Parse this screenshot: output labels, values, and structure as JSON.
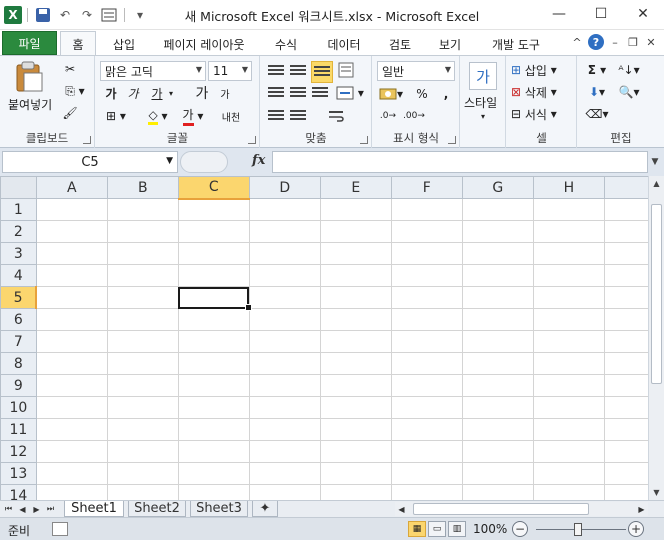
{
  "window": {
    "title": "새 Microsoft Excel 워크시트.xlsx  -  Microsoft Excel",
    "controls": {
      "minimize": "—",
      "restore": "☐",
      "close": "✕"
    }
  },
  "qat": {
    "logo": "X",
    "undo": "↶",
    "redo": "↷",
    "dropdown": "▾"
  },
  "tabs": {
    "file": "파일",
    "items": [
      {
        "label": "홈",
        "active": true
      },
      {
        "label": "삽입"
      },
      {
        "label": "페이지 레이아웃"
      },
      {
        "label": "수식"
      },
      {
        "label": "데이터"
      },
      {
        "label": "검토"
      },
      {
        "label": "보기"
      },
      {
        "label": "개발 도구"
      }
    ]
  },
  "ribbon": {
    "clipboard": {
      "paste_label": "붙여넣기",
      "group_label": "클립보드"
    },
    "font": {
      "font_name": "맑은 고딕",
      "font_size": "11",
      "bold": "가",
      "italic": "가",
      "underline": "가",
      "grow": "가",
      "shrink": "가",
      "font_color_glyph": "가",
      "phonetic": "내천",
      "group_label": "글꼴"
    },
    "alignment": {
      "group_label": "맞춤"
    },
    "number": {
      "format": "일반",
      "percent": "%",
      "comma": ",",
      "group_label": "표시 형식"
    },
    "styles": {
      "label": "스타일",
      "glyph": "가"
    },
    "cells": {
      "insert": "삽입",
      "delete": "삭제",
      "format": "서식",
      "group_label": "셀"
    },
    "editing": {
      "sum": "Σ",
      "group_label": "편집"
    }
  },
  "formula_bar": {
    "name_box": "C5",
    "fx": "fx",
    "value": ""
  },
  "grid": {
    "columns": [
      "A",
      "B",
      "C",
      "D",
      "E",
      "F",
      "G",
      "H"
    ],
    "rows": [
      "1",
      "2",
      "3",
      "4",
      "5",
      "6",
      "7",
      "8",
      "9",
      "10",
      "11",
      "12",
      "13",
      "14"
    ],
    "active_col": "C",
    "active_row": "5"
  },
  "sheets": [
    {
      "label": "Sheet1",
      "active": true
    },
    {
      "label": "Sheet2"
    },
    {
      "label": "Sheet3"
    }
  ],
  "status": {
    "ready": "준비",
    "zoom": "100%"
  },
  "colors": {
    "file_tab": "#2b8a3e",
    "active_header": "#fbd66e",
    "accent_border": "#e8a13b"
  }
}
